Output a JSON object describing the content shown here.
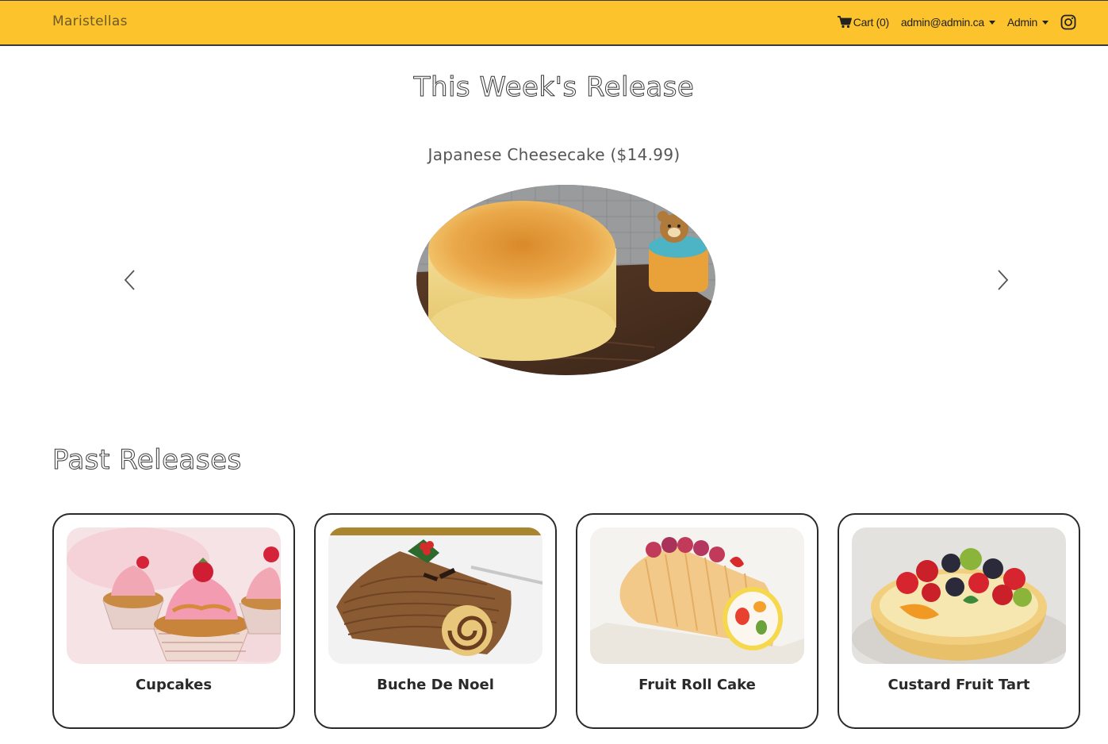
{
  "navbar": {
    "brand": "Maristellas",
    "cart_label": "Cart (0)",
    "user_menu_label": "admin@admin.ca",
    "admin_menu_label": "Admin",
    "icons": {
      "cart": "cart-icon",
      "instagram": "instagram-icon",
      "dropdown": "chevron-down-icon"
    },
    "background_color": "#fcc32c"
  },
  "weekly_release": {
    "title": "This Week's Release",
    "product_label": "Japanese Cheesecake ($14.99)",
    "image": "japanese-cheesecake-image",
    "controls": {
      "prev": "chevron-left-icon",
      "next": "chevron-right-icon"
    }
  },
  "past_releases": {
    "title": "Past Releases",
    "items": [
      {
        "name": "Cupcakes",
        "image": "cupcakes-image"
      },
      {
        "name": "Buche De Noel",
        "image": "buche-de-noel-image"
      },
      {
        "name": "Fruit Roll Cake",
        "image": "fruit-roll-cake-image"
      },
      {
        "name": "Custard Fruit Tart",
        "image": "custard-fruit-tart-image"
      }
    ]
  }
}
